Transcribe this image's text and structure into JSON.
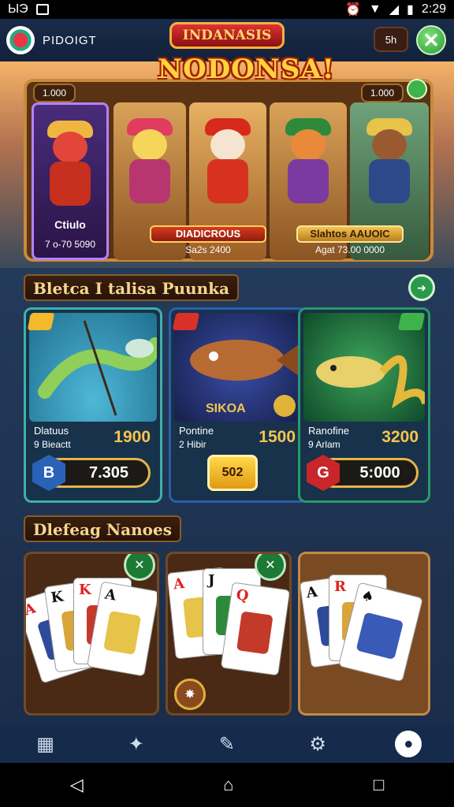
{
  "status_bar": {
    "left_text": "ЫЭ",
    "time": "2:29"
  },
  "header": {
    "app_name": "PIDOIGT",
    "timer_badge": "5h",
    "close_icon": "close-icon"
  },
  "banner": {
    "logo_small": "INDANASIS",
    "logo_big": "NODONSA!",
    "counter_left": "1.000",
    "counter_right": "1.000",
    "cards": [
      {
        "label": "Ctiulo",
        "sub": "7 o-70 5090"
      },
      {
        "label": "",
        "sub": ""
      },
      {
        "label": "",
        "sub": ""
      },
      {
        "label": "",
        "sub": ""
      },
      {
        "label": "",
        "sub": ""
      }
    ],
    "center_label": "DIADICROUS",
    "center_sub": "Sa2s 2400",
    "right_label": "Slahtos AAUOIC",
    "right_sub": "Agat 73.00 0000"
  },
  "section_fish": {
    "title": "Bletca I talisa Puunka",
    "items": [
      {
        "name": "Dlatuus",
        "sub": "9 Bieactt",
        "value": "1900",
        "price": "7.305",
        "icon_letter": "B",
        "icon_color": "#2a62b8"
      },
      {
        "name": "Pontine",
        "sub": "2 Hibir",
        "value": "1500",
        "price": "502",
        "art_text": "SIKOA"
      },
      {
        "name": "Ranofine",
        "sub": "9 Arlam",
        "value": "3200",
        "price": "5:000",
        "icon_letter": "G",
        "icon_color": "#c8262a"
      }
    ]
  },
  "section_cards": {
    "title": "Dlefeag Nanoes"
  },
  "colors": {
    "accent_gold": "#f4c44f",
    "teal_border": "#3fb0a8",
    "panel_dark": "#1a2d4a"
  }
}
